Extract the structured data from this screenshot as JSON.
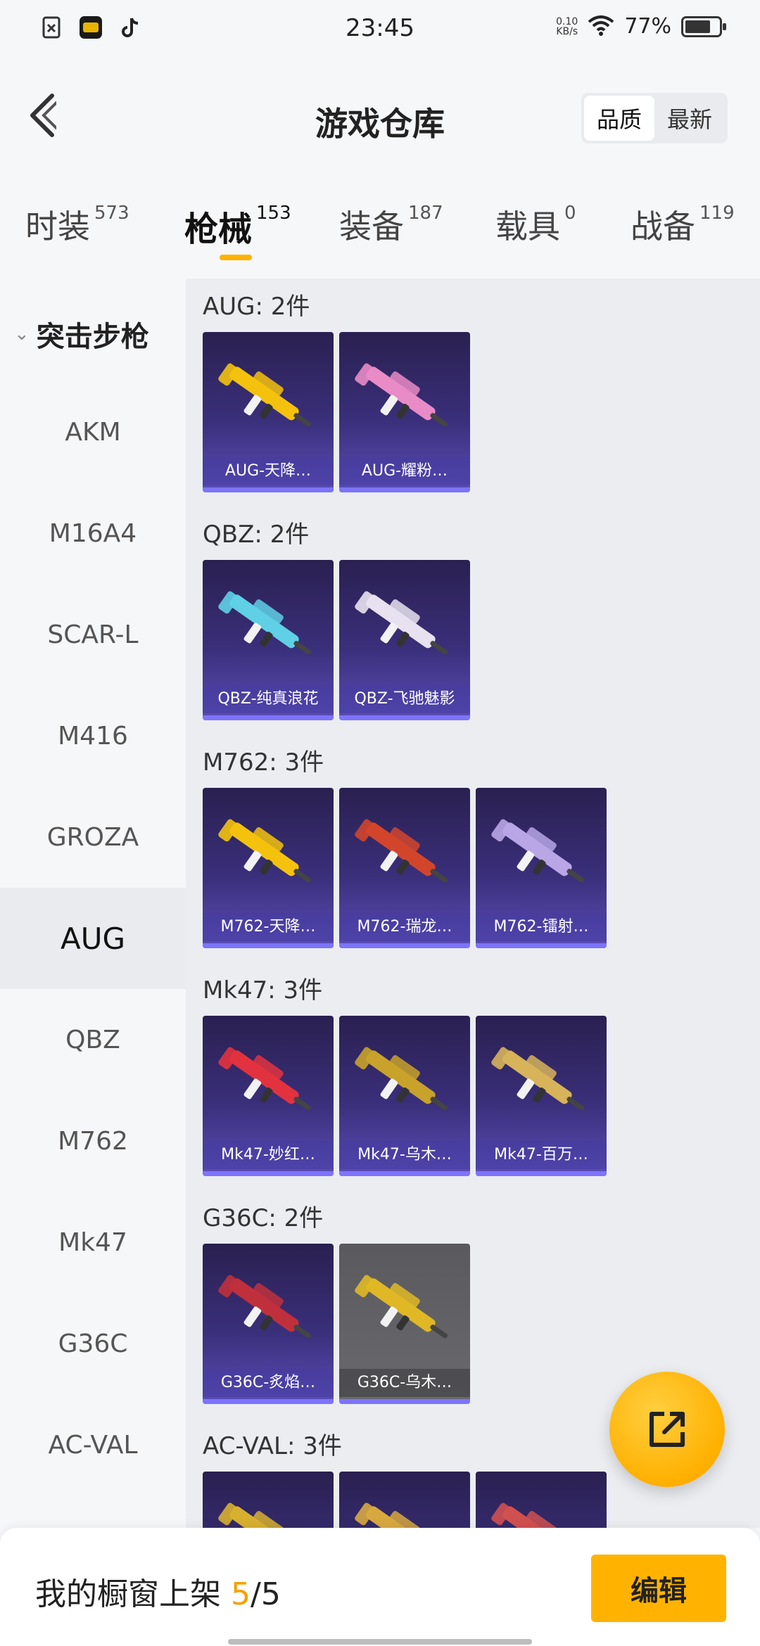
{
  "status_bar": {
    "time": "23:45",
    "net_speed_value": "0.10",
    "net_speed_unit": "KB/s",
    "battery": "77%",
    "battery_level_pct": 77
  },
  "header": {
    "title": "游戏仓库",
    "sort_options": [
      "品质",
      "最新"
    ],
    "sort_active": "品质"
  },
  "tabs": [
    {
      "label": "时装",
      "count": "573"
    },
    {
      "label": "枪械",
      "count": "153",
      "active": true
    },
    {
      "label": "装备",
      "count": "187"
    },
    {
      "label": "载具",
      "count": "0"
    },
    {
      "label": "战备",
      "count": "119"
    }
  ],
  "sidebar": {
    "group": "突击步枪",
    "items": [
      "AKM",
      "M16A4",
      "SCAR-L",
      "M416",
      "GROZA",
      "AUG",
      "QBZ",
      "M762",
      "Mk47",
      "G36C",
      "AC-VAL"
    ],
    "active": "AUG"
  },
  "sections": [
    {
      "title": "AUG: 2件",
      "items": [
        {
          "name": "AUG-天降…",
          "color": "#f4c20d",
          "style": "purple"
        },
        {
          "name": "AUG-耀粉…",
          "color": "#e98bc6",
          "style": "purple"
        }
      ]
    },
    {
      "title": "QBZ: 2件",
      "items": [
        {
          "name": "QBZ-纯真浪花",
          "color": "#5fd0e6",
          "style": "purple"
        },
        {
          "name": "QBZ-飞驰魅影",
          "color": "#e8e2f0",
          "style": "purple"
        }
      ]
    },
    {
      "title": "M762: 3件",
      "items": [
        {
          "name": "M762-天降…",
          "color": "#f4c20d",
          "style": "purple"
        },
        {
          "name": "M762-瑞龙…",
          "color": "#d2452b",
          "style": "purple"
        },
        {
          "name": "M762-镭射…",
          "color": "#b9a6e6",
          "style": "purple"
        }
      ]
    },
    {
      "title": "Mk47: 3件",
      "items": [
        {
          "name": "Mk47-妙红…",
          "color": "#e2323f",
          "style": "purple"
        },
        {
          "name": "Mk47-乌木…",
          "color": "#c8a22a",
          "style": "purple"
        },
        {
          "name": "Mk47-百万…",
          "color": "#d7b35a",
          "style": "purple"
        }
      ]
    },
    {
      "title": "G36C: 2件",
      "items": [
        {
          "name": "G36C-炙焰…",
          "color": "#c0303c",
          "style": "purple"
        },
        {
          "name": "G36C-乌木…",
          "color": "#e0b825",
          "style": "gray"
        }
      ]
    },
    {
      "title": "AC-VAL: 3件",
      "items": [
        {
          "name": "",
          "color": "#d8b030",
          "style": "purple"
        },
        {
          "name": "",
          "color": "#d8a840",
          "style": "purple"
        },
        {
          "name": "",
          "color": "#d05050",
          "style": "purple"
        }
      ]
    }
  ],
  "bottom_bar": {
    "label": "我的橱窗上架",
    "current": "5",
    "sep_total": "/5",
    "edit_label": "编辑"
  },
  "icons": [
    "back-icon",
    "share-icon",
    "wifi-icon",
    "battery-icon",
    "chevron-down-icon"
  ]
}
